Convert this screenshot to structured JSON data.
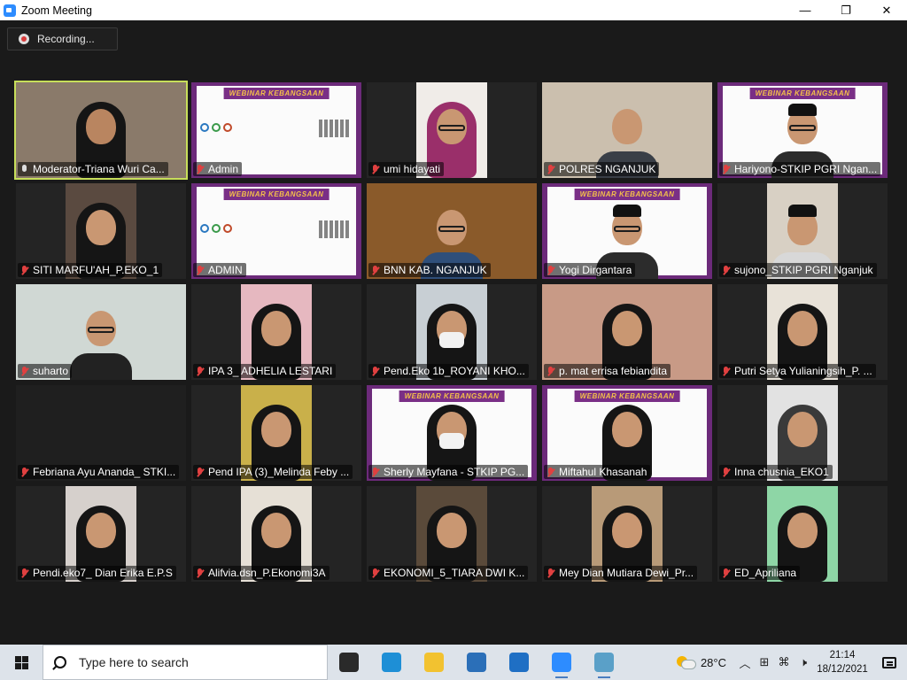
{
  "window": {
    "title": "Zoom Meeting",
    "minimize": "—",
    "maximize": "❐",
    "close": "✕"
  },
  "recording": {
    "label": "Recording..."
  },
  "participants": [
    {
      "name": "Moderator-Triana Wuri Ca...",
      "row": 0,
      "col": 0,
      "video": "camera",
      "active": true,
      "host": true,
      "bg": "#8a7a6a",
      "skin": "#b98560",
      "type": "hijab"
    },
    {
      "name": "Admin",
      "row": 0,
      "col": 1,
      "video": "banner"
    },
    {
      "name": "umi hidayati",
      "row": 0,
      "col": 2,
      "video": "camera",
      "narrow": true,
      "bg": "#f0ece8",
      "type": "hijab",
      "hijabColor": "#9a2f6a",
      "glasses": true
    },
    {
      "name": "POLRES NGANJUK",
      "row": 0,
      "col": 3,
      "video": "camera",
      "bg": "#cbbfae",
      "type": "man",
      "bodyColor": "#3a3f47"
    },
    {
      "name": "Hariyono-STKIP PGRI Ngan...",
      "row": 0,
      "col": 4,
      "video": "banner",
      "person": "man-hat-glasses"
    },
    {
      "name": "SITI MARFU'AH_P.EKO_1",
      "row": 1,
      "col": 0,
      "video": "camera",
      "narrow": true,
      "bg": "#5a4a40",
      "type": "hijab"
    },
    {
      "name": "ADMIN",
      "row": 1,
      "col": 1,
      "video": "banner"
    },
    {
      "name": "BNN KAB. NGANJUK",
      "row": 1,
      "col": 2,
      "video": "camera",
      "bg": "#8a5a2a",
      "type": "man-glasses",
      "bodyColor": "#2f4f7a"
    },
    {
      "name": "Yogi Dirgantara",
      "row": 1,
      "col": 3,
      "video": "banner",
      "person": "man-hat-glasses"
    },
    {
      "name": "sujono_STKIP PGRI Nganjuk",
      "row": 1,
      "col": 4,
      "video": "camera",
      "narrow": true,
      "bg": "#d8d0c4",
      "type": "man-hat",
      "bodyColor": "#d8d8d8"
    },
    {
      "name": "suharto",
      "row": 2,
      "col": 0,
      "video": "camera",
      "bg": "#d0d8d4",
      "type": "man-glasses",
      "bodyColor": "#222"
    },
    {
      "name": "IPA 3_ ADHELIA LESTARI",
      "row": 2,
      "col": 1,
      "video": "camera",
      "narrow": true,
      "bg": "#e6b8c0",
      "type": "hijab"
    },
    {
      "name": "Pend.Eko 1b_ROYANI KHO...",
      "row": 2,
      "col": 2,
      "video": "camera",
      "narrow": true,
      "bg": "#c8cfd4",
      "type": "hijab-mask"
    },
    {
      "name": "p. mat errisa febiandita",
      "row": 2,
      "col": 3,
      "video": "camera",
      "bg": "#c89a86",
      "type": "hijab"
    },
    {
      "name": "Putri Setya Yulianingsih_P. ...",
      "row": 2,
      "col": 4,
      "video": "camera",
      "narrow": true,
      "bg": "#e8e2d8",
      "type": "hijab"
    },
    {
      "name": "Febriana Ayu Ananda_ STKI...",
      "row": 3,
      "col": 0,
      "video": "camera",
      "bg": "#1f1f1f",
      "type": "none"
    },
    {
      "name": "Pend IPA (3)_Melinda Feby ...",
      "row": 3,
      "col": 1,
      "video": "camera",
      "narrow": true,
      "bg": "#c9b04a",
      "type": "hijab"
    },
    {
      "name": "Sherly Mayfana - STKIP PG...",
      "row": 3,
      "col": 2,
      "video": "banner",
      "person": "hijab-mask"
    },
    {
      "name": "Miftahul Khasanah",
      "row": 3,
      "col": 3,
      "video": "banner",
      "person": "hijab"
    },
    {
      "name": "Inna chusnia_EKO1",
      "row": 3,
      "col": 4,
      "video": "camera",
      "narrow": true,
      "bg": "#e2e2e2",
      "type": "hijab",
      "hijabColor": "#3a3a3a"
    },
    {
      "name": "Pendi.eko7_ Dian Erika E.P.S",
      "row": 4,
      "col": 0,
      "video": "camera",
      "narrow": true,
      "bg": "#d6d0cc",
      "type": "hijab"
    },
    {
      "name": "Alifvia.dsn_P.Ekonomi3A",
      "row": 4,
      "col": 1,
      "video": "camera",
      "narrow": true,
      "bg": "#e6e0d6",
      "type": "hijab"
    },
    {
      "name": "EKONOMI_5_TIARA DWI K...",
      "row": 4,
      "col": 2,
      "video": "camera",
      "narrow": true,
      "bg": "#5a4a3a",
      "type": "hijab"
    },
    {
      "name": "Mey Dian Mutiara Dewi_Pr...",
      "row": 4,
      "col": 3,
      "video": "camera",
      "narrow": true,
      "bg": "#b89a78",
      "type": "hijab"
    },
    {
      "name": "ED_Apriliana",
      "row": 4,
      "col": 4,
      "video": "camera",
      "narrow": true,
      "bg": "#8ed6a6",
      "type": "hijab"
    }
  ],
  "banner": {
    "title": "WEBINAR KEBANGSAAN"
  },
  "taskbar": {
    "search_placeholder": "Type here to search",
    "weather_temp": "28°C",
    "time": "21:14",
    "date": "18/12/2021",
    "apps": [
      {
        "name": "task-view-icon",
        "color": "#2a2a2a"
      },
      {
        "name": "edge-icon",
        "color": "#1e8fd6"
      },
      {
        "name": "file-explorer-icon",
        "color": "#f2c230"
      },
      {
        "name": "store-icon",
        "color": "#2b6fb8"
      },
      {
        "name": "mail-icon",
        "color": "#1f6fc4"
      },
      {
        "name": "zoom-icon",
        "color": "#2d8cff",
        "running": true
      },
      {
        "name": "app-icon",
        "color": "#5aa0c8",
        "running": true
      }
    ],
    "tray_symbols": [
      "︿",
      "⊞",
      "⌘",
      "🕨"
    ]
  },
  "colors": {
    "active_border": "#c7de5a",
    "muted_mic": "#e04040",
    "banner_purple": "#6c2a7a",
    "banner_gold": "#f4c04a"
  }
}
